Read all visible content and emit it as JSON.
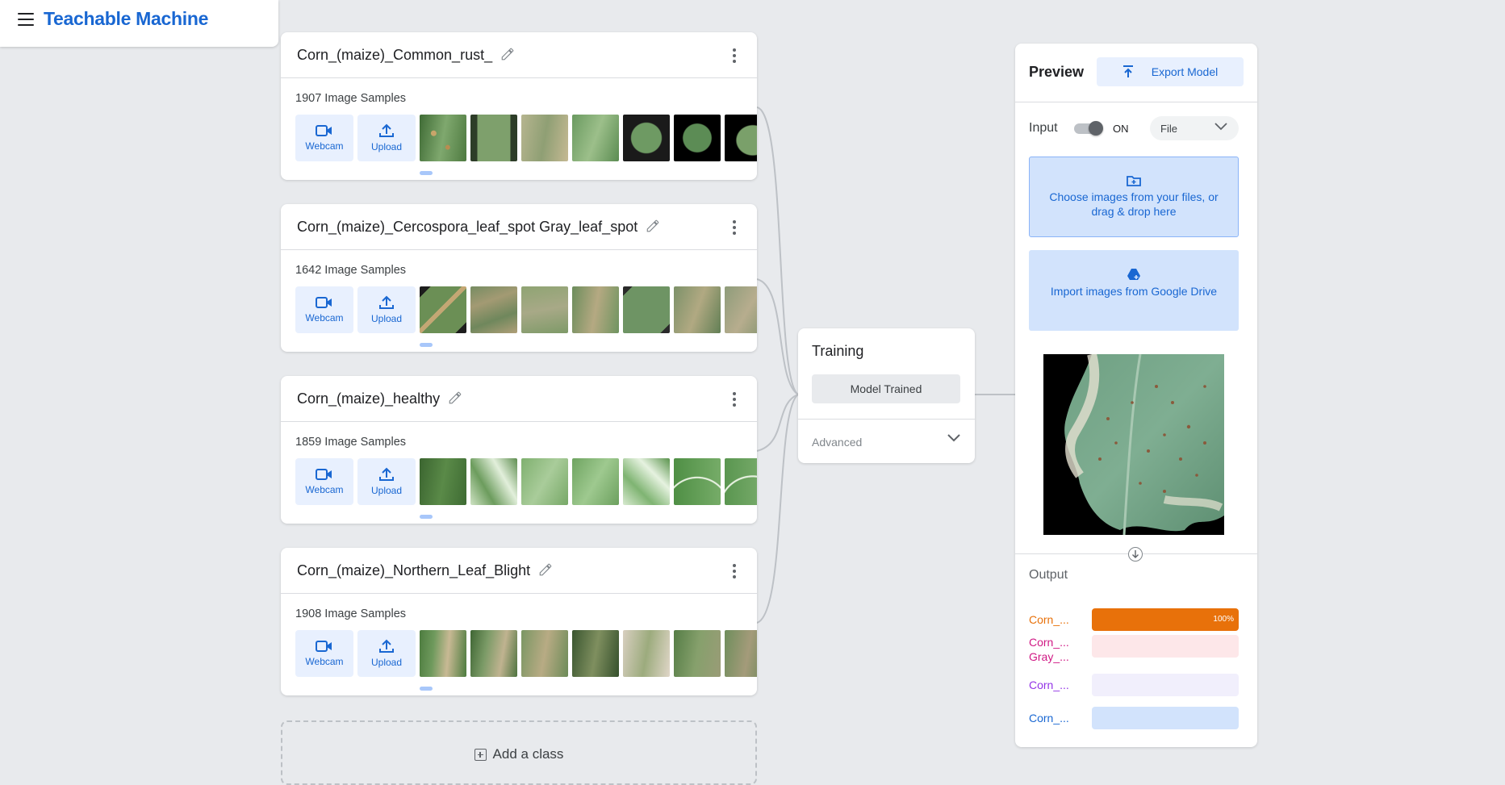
{
  "app": {
    "title": "Teachable Machine"
  },
  "classes": [
    {
      "name": "Corn_(maize)_Common_rust_",
      "samples": "1907 Image Samples",
      "thumbs": [
        "#6f9a63",
        "#7f9d6c",
        "#9da97e",
        "#86a774",
        "#6c8f5f",
        "#5a8c55",
        "#76a06a"
      ]
    },
    {
      "name": "Corn_(maize)_Cercospora_leaf_spot Gray_leaf_spot",
      "samples": "1642 Image Samples",
      "thumbs": [
        "#6a8c58",
        "#7d9266",
        "#93a578",
        "#869c6e",
        "#6f8a60",
        "#7a8f6c",
        "#889a77"
      ]
    },
    {
      "name": "Corn_(maize)_healthy",
      "samples": "1859 Image Samples",
      "thumbs": [
        "#4e7a3e",
        "#8fb487",
        "#86b078",
        "#7fab73",
        "#9fc394",
        "#5f9b55",
        "#7db070"
      ]
    },
    {
      "name": "Corn_(maize)_Northern_Leaf_Blight",
      "samples": "1908 Image Samples",
      "thumbs": [
        "#5e8c4c",
        "#6b8f58",
        "#89a069",
        "#556f3f",
        "#a8a785",
        "#6f9a5e",
        "#7e9a68"
      ]
    }
  ],
  "class_buttons": {
    "webcam": "Webcam",
    "upload": "Upload"
  },
  "add_class": "Add a class",
  "training": {
    "title": "Training",
    "button": "Model Trained",
    "advanced": "Advanced"
  },
  "preview": {
    "title": "Preview",
    "export": "Export Model",
    "input_label": "Input",
    "toggle_state": "ON",
    "source": "File",
    "choose_files": "Choose images from your files, or drag & drop here",
    "import_drive": "Import images from Google Drive",
    "output_label": "Output",
    "outputs": [
      {
        "label": "Corn_...",
        "percent": 100,
        "pct_text": "100%",
        "color": "#e8710a",
        "track": "#fde3cf"
      },
      {
        "label": "Corn_...\nGray_...",
        "percent": 0,
        "pct_text": "",
        "color": "#d01884",
        "track": "#fde7e9"
      },
      {
        "label": "Corn_...",
        "percent": 0,
        "pct_text": "",
        "color": "#9334e6",
        "track": "#f1effc"
      },
      {
        "label": "Corn_...",
        "percent": 0,
        "pct_text": "",
        "color": "#1967d2",
        "track": "#d2e3fc"
      }
    ]
  },
  "colors": {
    "accent": "#1967d2",
    "background": "#e8eaed"
  }
}
